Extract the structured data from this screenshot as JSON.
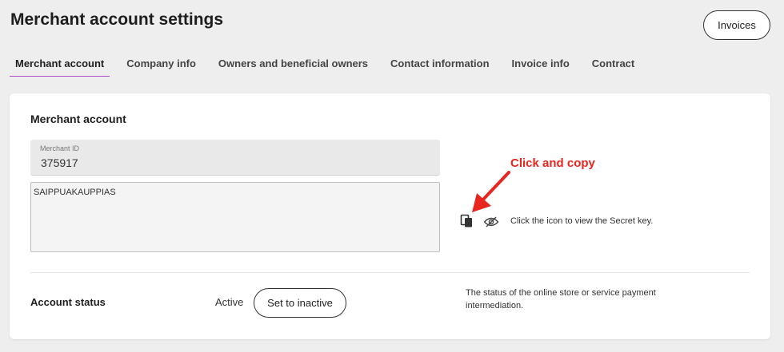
{
  "header": {
    "title": "Merchant account settings",
    "invoices_label": "Invoices"
  },
  "tabs": [
    {
      "label": "Merchant account",
      "active": true
    },
    {
      "label": "Company info"
    },
    {
      "label": "Owners and beneficial owners"
    },
    {
      "label": "Contact information"
    },
    {
      "label": "Invoice info"
    },
    {
      "label": "Contract"
    }
  ],
  "merchant": {
    "section_title": "Merchant account",
    "id_label": "Merchant ID",
    "id_value": "375917",
    "secret_text": "SAIPPUAKAUPPIAS",
    "secret_hint": "Click the icon to view the Secret key.",
    "copy_icon": "copy-icon",
    "eye_icon": "eye-slash-icon"
  },
  "annotation": {
    "text": "Click and copy",
    "color": "#e8251f"
  },
  "status": {
    "label": "Account status",
    "value": "Active",
    "button_label": "Set to inactive",
    "description": "The status of the online store or service payment intermediation."
  },
  "colors": {
    "active_tab_underline": "#b14bc8"
  }
}
